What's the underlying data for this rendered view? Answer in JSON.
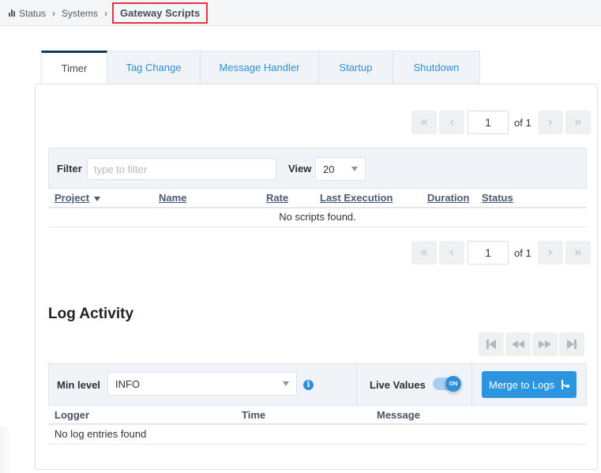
{
  "breadcrumb": {
    "icon": "bar-chart-icon",
    "items": [
      "Status",
      "Systems"
    ],
    "current": "Gateway Scripts",
    "separator": "›"
  },
  "tabs": [
    {
      "label": "Timer",
      "active": true
    },
    {
      "label": "Tag Change",
      "active": false
    },
    {
      "label": "Message Handler",
      "active": false
    },
    {
      "label": "Startup",
      "active": false
    },
    {
      "label": "Shutdown",
      "active": false
    }
  ],
  "pager_top": {
    "first": "«",
    "prev": "‹",
    "page": "1",
    "of_label": "of 1",
    "next": "›",
    "last": "»"
  },
  "pager_bottom": {
    "first": "«",
    "prev": "‹",
    "page": "1",
    "of_label": "of 1",
    "next": "›",
    "last": "»"
  },
  "filter": {
    "label": "Filter",
    "placeholder": "type to filter",
    "value": ""
  },
  "view": {
    "label": "View",
    "selected": "20"
  },
  "scripts_table": {
    "columns": [
      "Project",
      "Name",
      "Rate",
      "Last Execution",
      "Duration",
      "Status"
    ],
    "sorted_column": "Project",
    "empty_message": "No scripts found."
  },
  "log": {
    "title": "Log Activity",
    "media_controls": [
      "skip-first-icon",
      "rewind-icon",
      "fast-forward-icon",
      "skip-last-icon"
    ],
    "min_level_label": "Min level",
    "min_level_selected": "INFO",
    "live_values_label": "Live Values",
    "live_values_state": "ON",
    "merge_button": "Merge to Logs",
    "columns": [
      "Logger",
      "Time",
      "Message"
    ],
    "empty_message": "No log entries found"
  },
  "colors": {
    "accent": "#2b95e0",
    "tab_active_border": "#123a5c",
    "highlight_box": "#e8363f"
  }
}
